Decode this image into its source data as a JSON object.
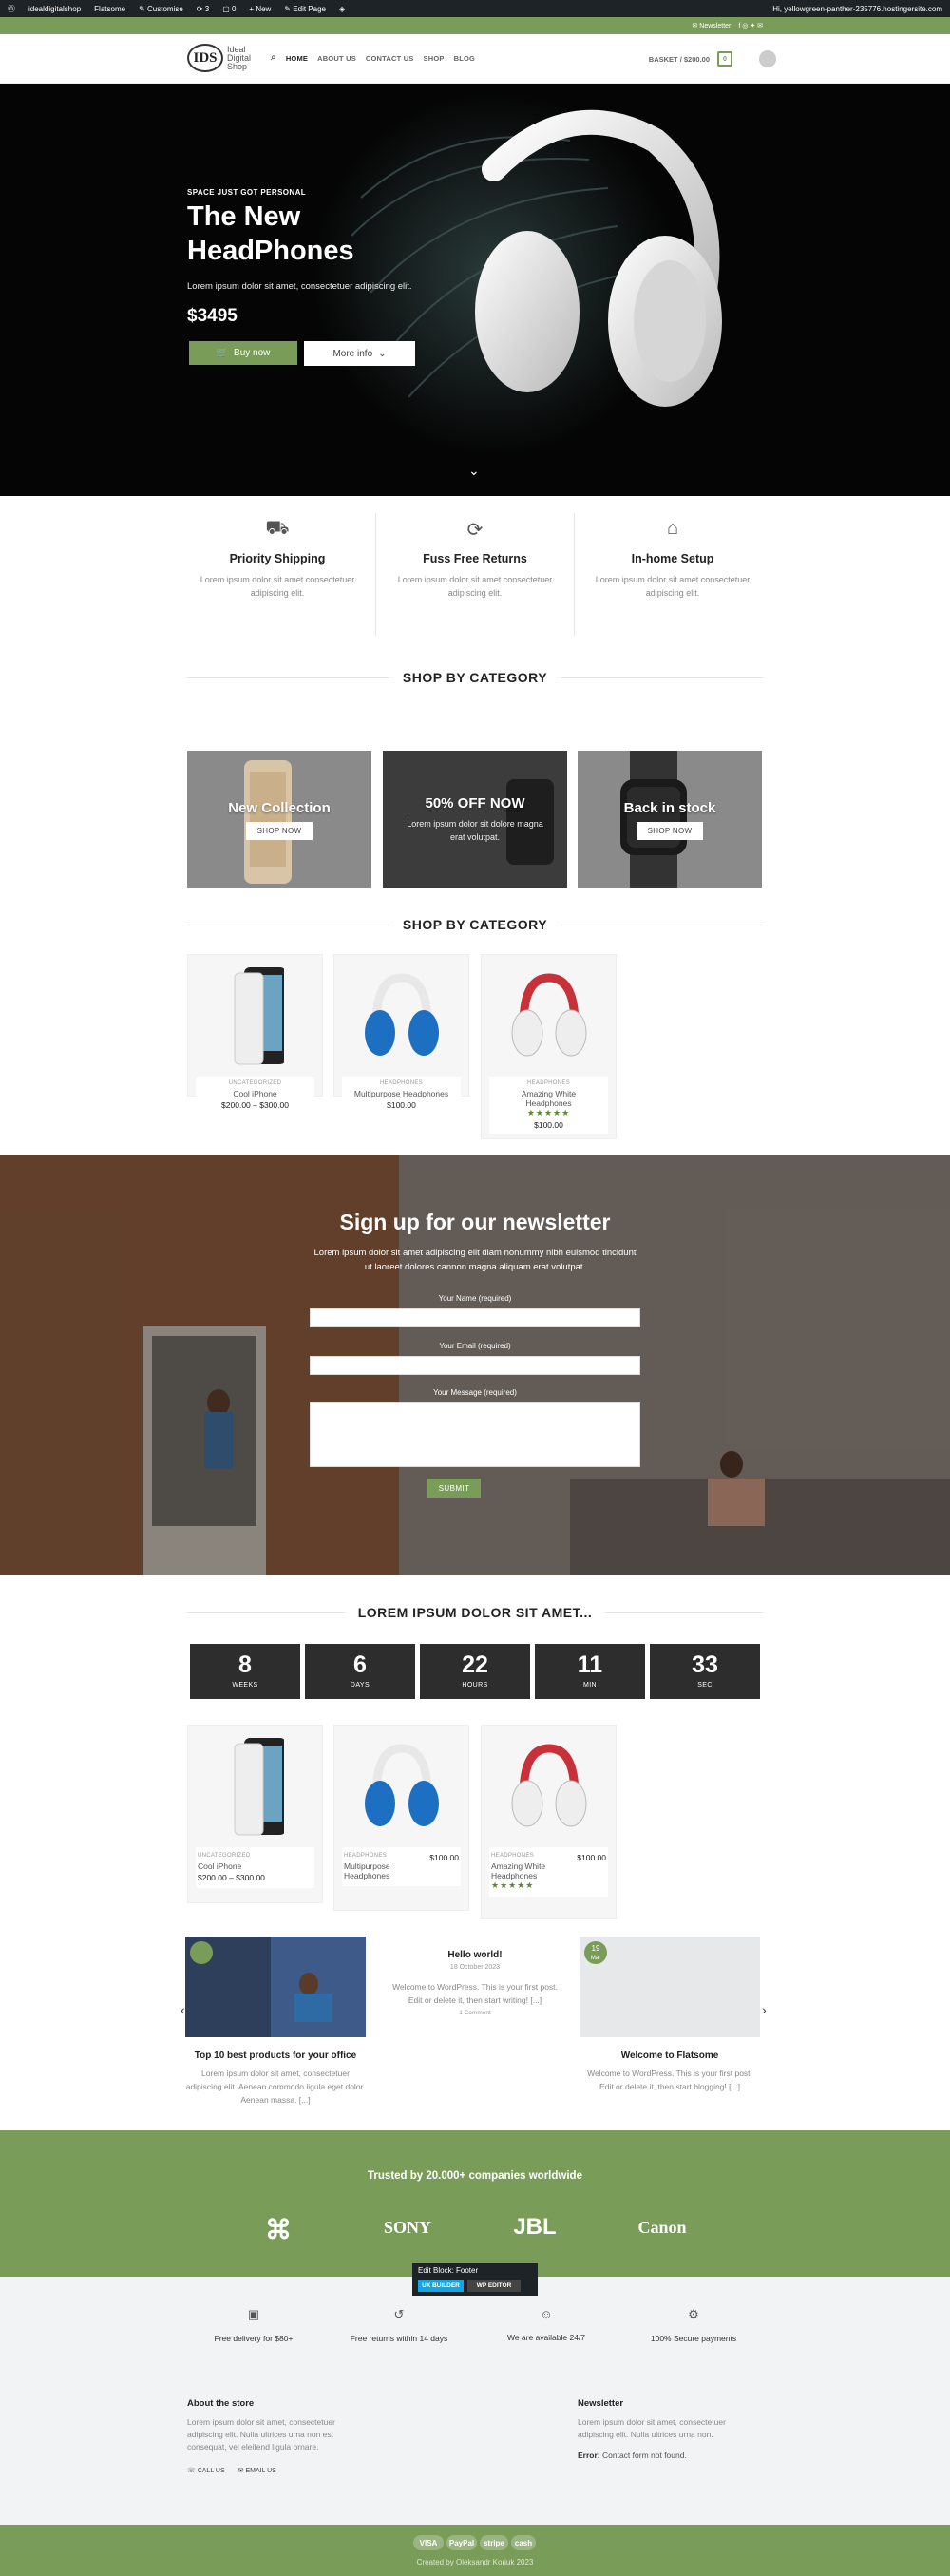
{
  "admin_bar": {
    "wp_logo": "wordpress-icon",
    "site": "idealdigitalshop",
    "flatsome": "Flatsome",
    "customise": "Customise",
    "comments": "3",
    "updates": "0",
    "new": "New",
    "edit_page": "Edit Page",
    "greeting": "Hi, yellowgreen-panther-235776.hostingersite.com"
  },
  "top_bar": {
    "newsletter": "Newsletter"
  },
  "header": {
    "logo_mark": "IDS",
    "logo_lines": [
      "Ideal",
      "Digital",
      "Shop"
    ],
    "nav": [
      "HOME",
      "ABOUT US",
      "CONTACT US",
      "SHOP",
      "BLOG"
    ],
    "basket": "BASKET / $200.00",
    "cart_count": "0"
  },
  "hero": {
    "eyebrow": "SPACE JUST GOT PERSONAL",
    "title_line1": "The New",
    "title_line2": "HeadPhones",
    "desc": "Lorem ipsum dolor sit amet, consectetuer adipiscing elit.",
    "price": "$3495",
    "buy_label": "Buy now",
    "more_label": "More info"
  },
  "features": [
    {
      "icon": "truck-icon",
      "title": "Priority Shipping",
      "text": "Lorem ipsum dolor sit amet consectetuer adipiscing elit."
    },
    {
      "icon": "refresh-icon",
      "title": "Fuss Free Returns",
      "text": "Lorem ipsum dolor sit amet consectetuer adipiscing elit."
    },
    {
      "icon": "home-icon",
      "title": "In-home Setup",
      "text": "Lorem ipsum dolor sit amet consectetuer adipiscing elit."
    }
  ],
  "shop_by_category_1": "SHOP BY CATEGORY",
  "banners": [
    {
      "title": "New Collection",
      "button": "SHOP NOW"
    },
    {
      "title": "50% OFF NOW",
      "text": "Lorem ipsum dolor sit dolore magna erat volutpat."
    },
    {
      "title": "Back in stock",
      "button": "SHOP NOW"
    }
  ],
  "shop_by_category_2": "SHOP BY CATEGORY",
  "products": [
    {
      "cat": "UNCATEGORIZED",
      "name": "Cool iPhone",
      "price": "$200.00 – $300.00"
    },
    {
      "cat": "HEADPHONES",
      "name": "Multipurpose Headphones",
      "price": "$100.00"
    },
    {
      "cat": "HEADPHONES",
      "name": "Amazing White Headphones",
      "price": "$100.00",
      "rating": 5
    }
  ],
  "newsletter": {
    "title": "Sign up for our newsletter",
    "desc": "Lorem ipsum dolor sit amet adipiscing elit diam nonummy nibh euismod tincidunt ut laoreet dolores cannon magna aliquam erat volutpat.",
    "name_label": "Your Name (required)",
    "email_label": "Your Email (required)",
    "message_label": "Your Message (required)",
    "submit": "SUBMIT"
  },
  "countdown": {
    "title": "LOREM IPSUM DOLOR SIT AMET...",
    "items": [
      {
        "n": "8",
        "u": "WEEKS"
      },
      {
        "n": "6",
        "u": "DAYS"
      },
      {
        "n": "22",
        "u": "HOURS"
      },
      {
        "n": "11",
        "u": "MIN"
      },
      {
        "n": "33",
        "u": "SEC"
      }
    ]
  },
  "products2": [
    {
      "cat": "UNCATEGORIZED",
      "name": "Cool iPhone",
      "price": "$200.00 – $300.00"
    },
    {
      "cat": "HEADPHONES",
      "name": "Multipurpose Headphones",
      "price": "$100.00"
    },
    {
      "cat": "HEADPHONES",
      "name": "Amazing White Headphones",
      "price": "$100.00",
      "rating": 5
    }
  ],
  "posts": [
    {
      "title": "Top 10 best products for your office",
      "text": "Lorem ipsum dolor sit amet, consectetuer adipiscing elit. Aenean commodo ligula eget dolor. Aenean massa. [...]"
    },
    {
      "title": "Hello world!",
      "date": "18 October 2023",
      "text": "Welcome to WordPress. This is your first post. Edit or delete it, then start writing! [...]",
      "comments": "1 Comment"
    },
    {
      "title": "Welcome to Flatsome",
      "badge_day": "19",
      "badge_mon": "Mar",
      "text": "Welcome to WordPress. This is your first post. Edit or delete it, then start blogging! [...]"
    }
  ],
  "trust": {
    "title": "Trusted by 20.000+ companies worldwide",
    "brands": [
      "SONY",
      "JBL",
      "Canon"
    ]
  },
  "edit_block": {
    "title": "Edit Block: Footer",
    "uxb": "UX BUILDER",
    "wp": "WP EDITOR"
  },
  "footer_features": [
    {
      "icon": "box-icon",
      "text": "Free delivery for $80+"
    },
    {
      "icon": "return-icon",
      "text": "Free returns within 14 days"
    },
    {
      "icon": "support-icon",
      "text": "We are available 24/7"
    },
    {
      "icon": "secure-icon",
      "text": "100% Secure payments"
    }
  ],
  "footer": {
    "about_title": "About the store",
    "about_text": "Lorem ipsum dolor sit amet, consectetuer adipiscing elit. Nulla ultrices urna non est consequat, vel eleifend ligula ornare.",
    "call": "CALL US",
    "email": "EMAIL US",
    "nl_title": "Newsletter",
    "nl_text": "Lorem ipsum dolor sit amet, consectetuer adipiscing elit. Nulla ultrices urna non.",
    "nl_error_label": "Error:",
    "nl_error": "Contact form not found."
  },
  "payments": [
    "VISA",
    "PayPal",
    "stripe",
    "cash"
  ],
  "copyright": "Created by Oleksandr Koriuk 2023"
}
